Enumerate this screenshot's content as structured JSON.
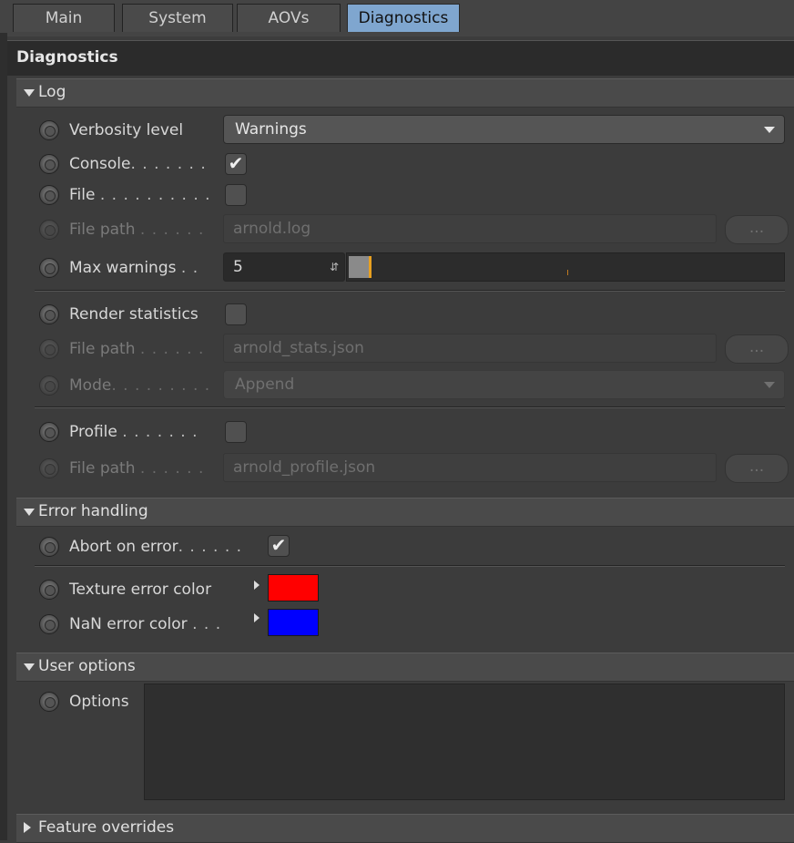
{
  "tabs": [
    {
      "label": "Main"
    },
    {
      "label": "System"
    },
    {
      "label": "AOVs"
    },
    {
      "label": "Diagnostics"
    }
  ],
  "panel_title": "Diagnostics",
  "sections": {
    "log": "Log",
    "error_handling": "Error handling",
    "user_options": "User options",
    "feature_overrides": "Feature overrides"
  },
  "log": {
    "verbosity_label": "Verbosity level",
    "verbosity_value": "Warnings",
    "console_label": "Console",
    "console_checked": "✔",
    "file_label": "File",
    "file_path_label": "File path",
    "file_path_value": "arnold.log",
    "max_warnings_label": "Max warnings",
    "max_warnings_value": "5",
    "render_stats_label": "Render statistics",
    "stats_path_label": "File path",
    "stats_path_value": "arnold_stats.json",
    "mode_label": "Mode",
    "mode_value": "Append",
    "profile_label": "Profile",
    "profile_path_label": "File path",
    "profile_path_value": "arnold_profile.json",
    "browse_label": "..."
  },
  "error": {
    "abort_label": "Abort on error",
    "abort_checked": "✔",
    "texture_label": "Texture error color",
    "texture_color": "#ff0000",
    "nan_label": "NaN error color",
    "nan_color": "#0000ff"
  },
  "user": {
    "options_label": "Options",
    "options_value": ""
  },
  "dots": {
    "console": ". . . . . . .",
    "file": ". . . . . . . . . .",
    "path": ". . . . . .",
    "maxw": ". .",
    "mode": ". . . . . . . . .",
    "profile": ". . . . . . .",
    "abort": ". . . . . .",
    "nan": ". . ."
  }
}
